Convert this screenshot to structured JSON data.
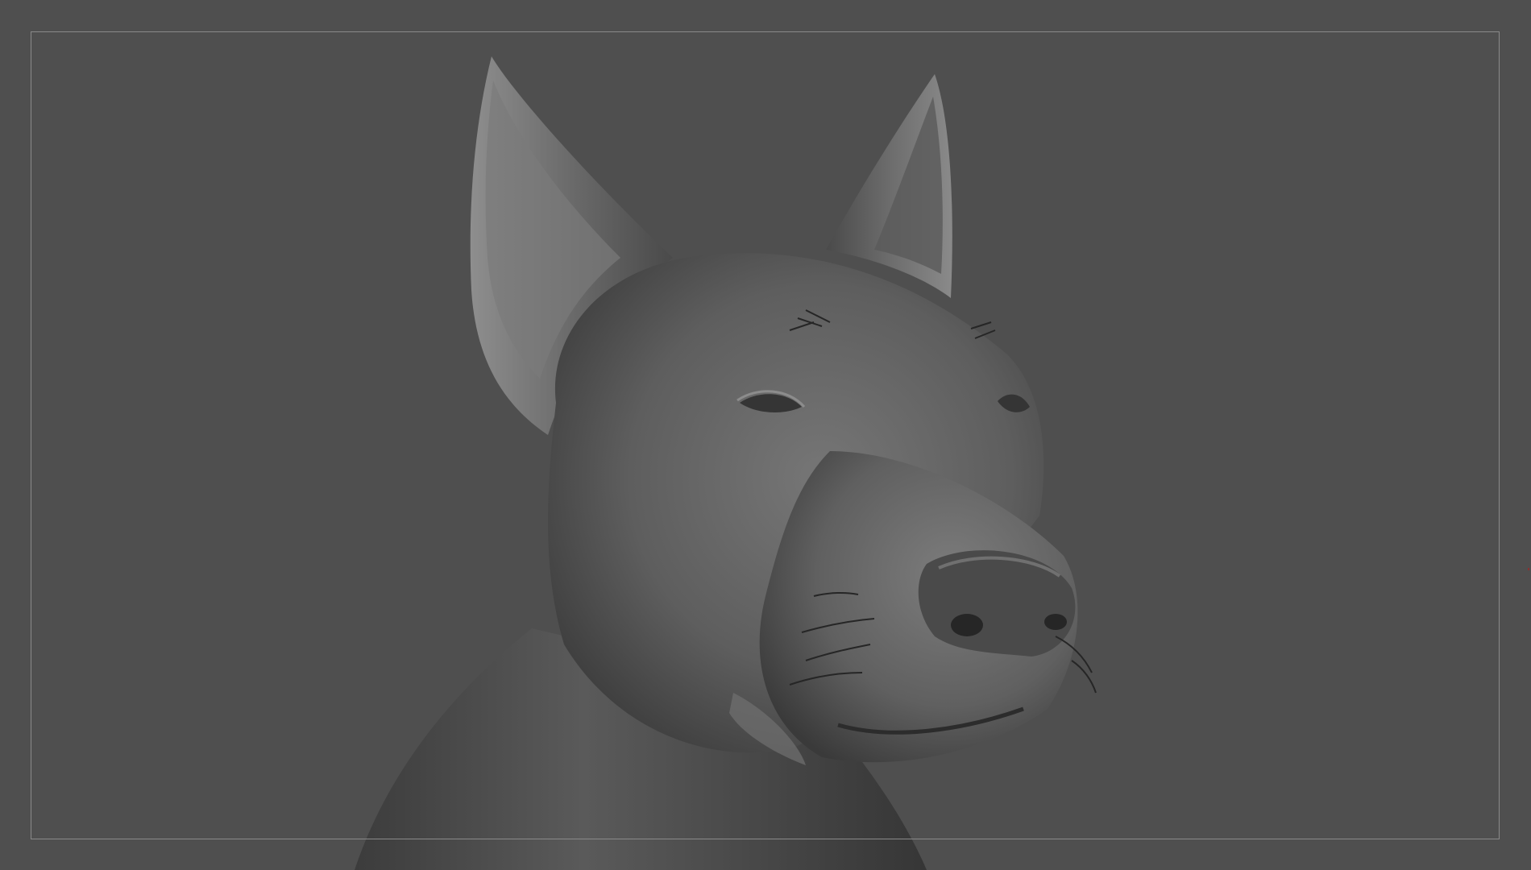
{
  "viewport": {
    "background_color": "#4f4f4f",
    "frame_color": "#8a8a8a"
  },
  "sculpt": {
    "subject": "dog-head-icon",
    "material_color": "#6a6a6a",
    "highlight_color": "#9a9a9a",
    "shadow_color": "#2e2e2e"
  }
}
